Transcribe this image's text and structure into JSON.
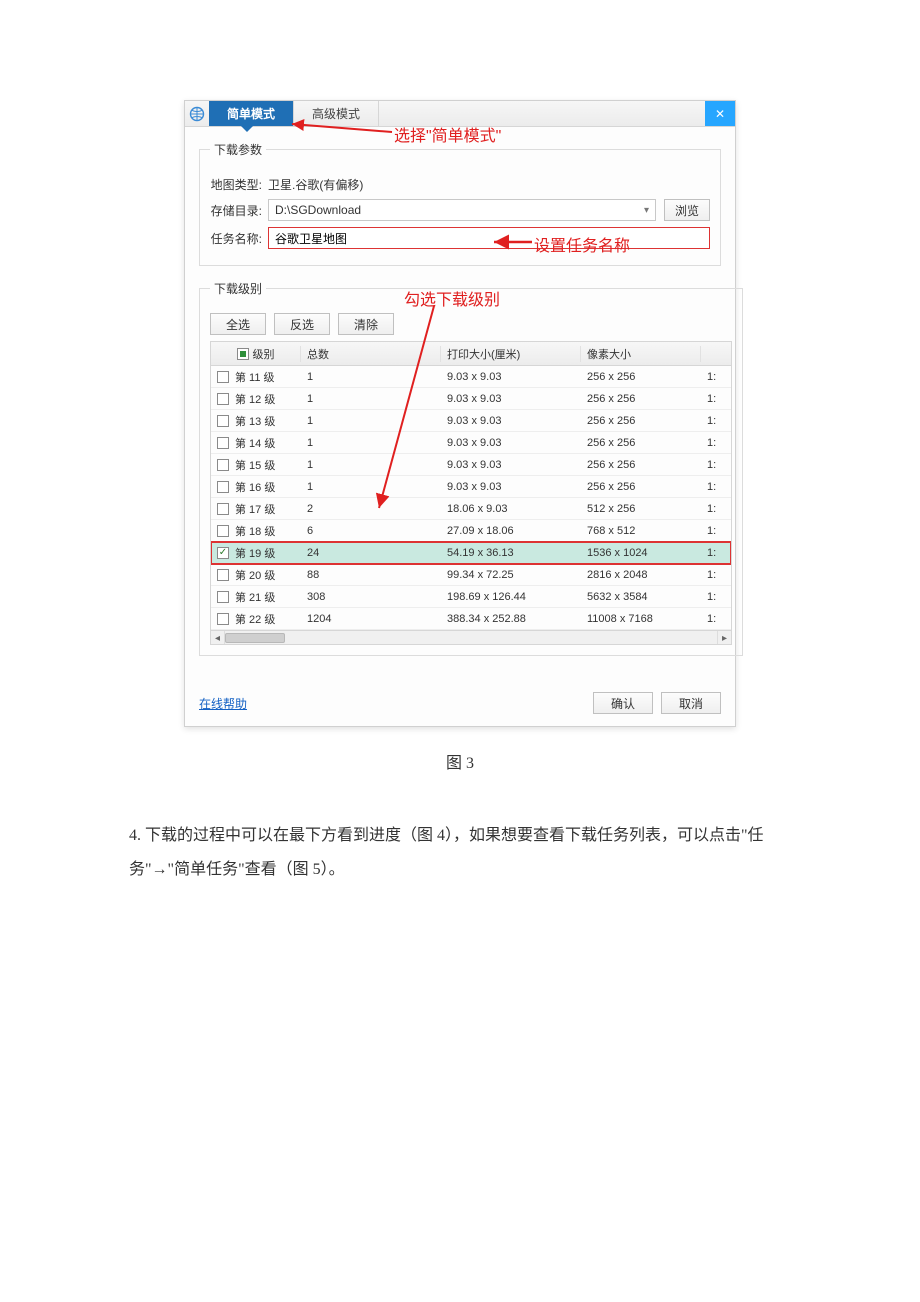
{
  "tabs": {
    "simple": "简单模式",
    "advanced": "高级模式"
  },
  "groups": {
    "params": "下载参数",
    "levels": "下载级别"
  },
  "labels": {
    "map_type": "地图类型:",
    "storage": "存储目录:",
    "task_name": "任务名称:"
  },
  "values": {
    "map_type": "卫星.谷歌(有偏移)",
    "storage": "D:\\SGDownload",
    "task_name": "谷歌卫星地图"
  },
  "buttons": {
    "browse": "浏览",
    "select_all": "全选",
    "invert": "反选",
    "clear": "清除",
    "ok": "确认",
    "cancel": "取消"
  },
  "headers": {
    "level": "级别",
    "count": "总数",
    "print": "打印大小(厘米)",
    "px": "像素大小"
  },
  "last_col": "1:",
  "rows": [
    {
      "level": "第 11 级",
      "count": "1",
      "print": "9.03 x 9.03",
      "px": "256 x 256",
      "chk": false,
      "sel": false
    },
    {
      "level": "第 12 级",
      "count": "1",
      "print": "9.03 x 9.03",
      "px": "256 x 256",
      "chk": false,
      "sel": false
    },
    {
      "level": "第 13 级",
      "count": "1",
      "print": "9.03 x 9.03",
      "px": "256 x 256",
      "chk": false,
      "sel": false
    },
    {
      "level": "第 14 级",
      "count": "1",
      "print": "9.03 x 9.03",
      "px": "256 x 256",
      "chk": false,
      "sel": false
    },
    {
      "level": "第 15 级",
      "count": "1",
      "print": "9.03 x 9.03",
      "px": "256 x 256",
      "chk": false,
      "sel": false
    },
    {
      "level": "第 16 级",
      "count": "1",
      "print": "9.03 x 9.03",
      "px": "256 x 256",
      "chk": false,
      "sel": false
    },
    {
      "level": "第 17 级",
      "count": "2",
      "print": "18.06 x 9.03",
      "px": "512 x 256",
      "chk": false,
      "sel": false
    },
    {
      "level": "第 18 级",
      "count": "6",
      "print": "27.09 x 18.06",
      "px": "768 x 512",
      "chk": false,
      "sel": false
    },
    {
      "level": "第 19 级",
      "count": "24",
      "print": "54.19 x 36.13",
      "px": "1536 x 1024",
      "chk": true,
      "sel": true
    },
    {
      "level": "第 20 级",
      "count": "88",
      "print": "99.34 x 72.25",
      "px": "2816 x 2048",
      "chk": false,
      "sel": false
    },
    {
      "level": "第 21 级",
      "count": "308",
      "print": "198.69 x 126.44",
      "px": "5632 x 3584",
      "chk": false,
      "sel": false
    },
    {
      "level": "第 22 级",
      "count": "1204",
      "print": "388.34 x 252.88",
      "px": "11008 x 7168",
      "chk": false,
      "sel": false
    }
  ],
  "footer": {
    "help": "在线帮助"
  },
  "annotations": {
    "choose_simple": "选择\"简单模式\"",
    "set_task_name": "设置任务名称",
    "check_levels": "勾选下载级别"
  },
  "caption": "图 3",
  "paragraph": "4. 下载的过程中可以在最下方看到进度（图 4），如果想要查看下载任务列表，可以点击\"任务\"→\"简单任务\"查看（图 5）。"
}
